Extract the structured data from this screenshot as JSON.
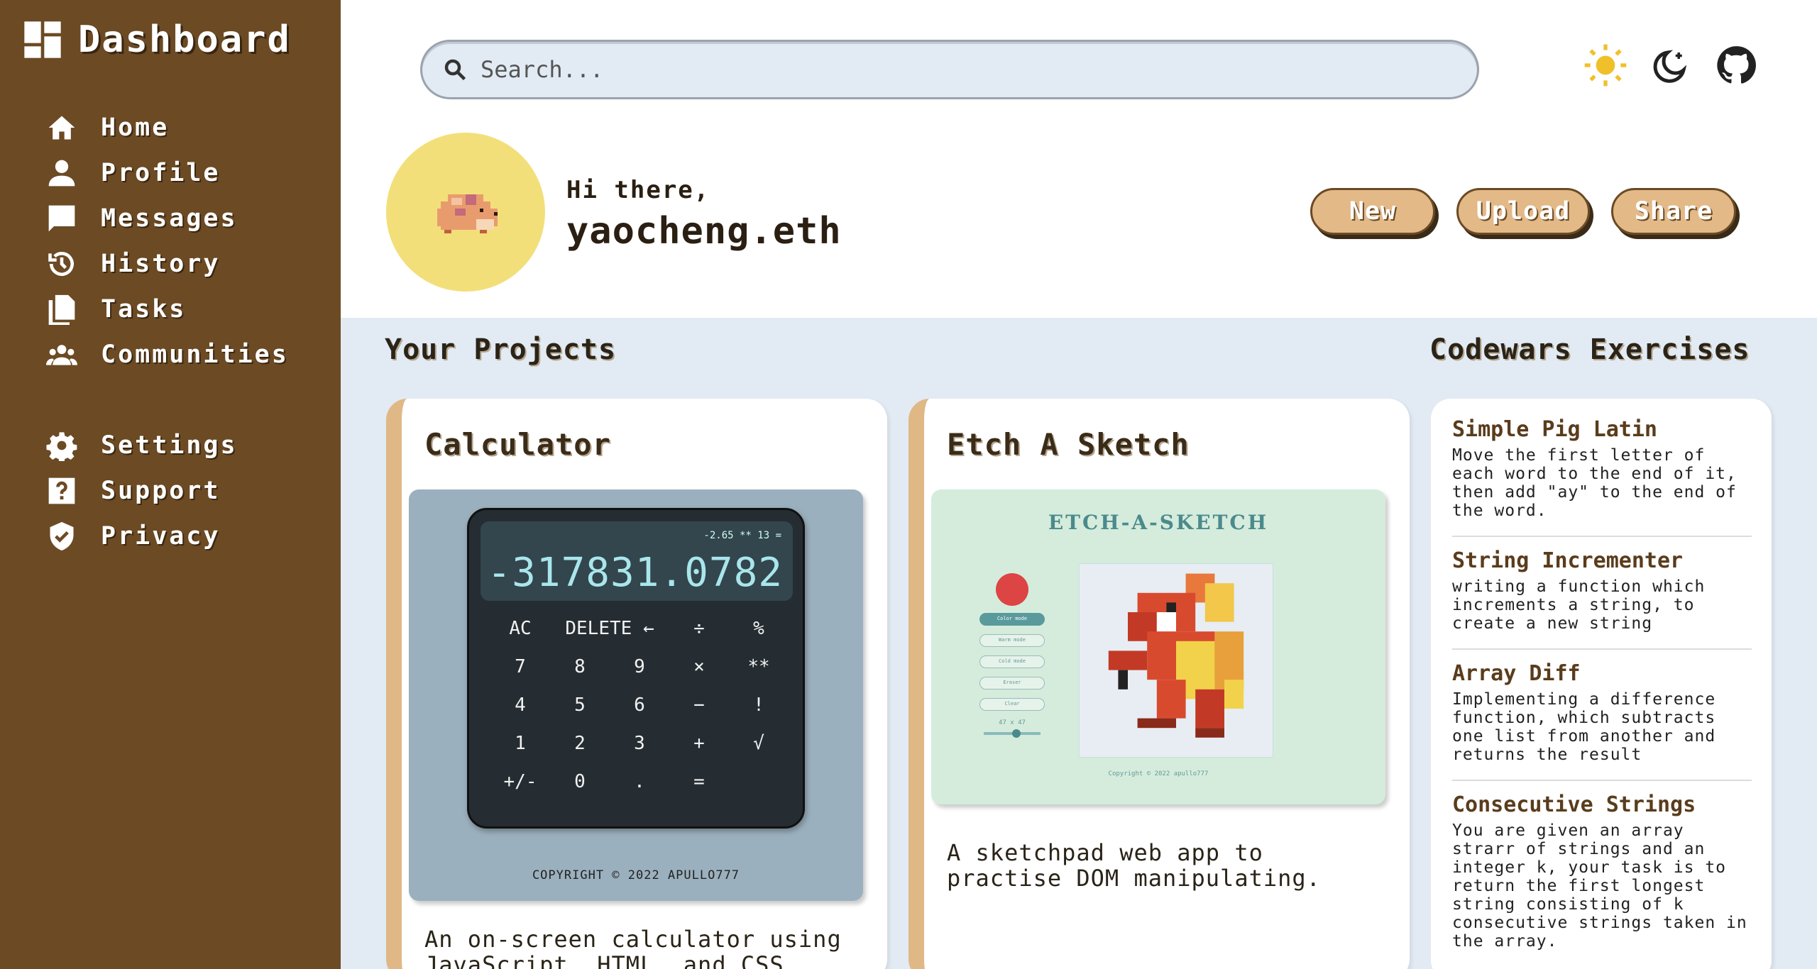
{
  "sidebar": {
    "brand": "Dashboard",
    "items": [
      {
        "label": "Home",
        "icon": "home-icon"
      },
      {
        "label": "Profile",
        "icon": "user-icon"
      },
      {
        "label": "Messages",
        "icon": "message-icon"
      },
      {
        "label": "History",
        "icon": "history-icon"
      },
      {
        "label": "Tasks",
        "icon": "tasks-icon"
      },
      {
        "label": "Communities",
        "icon": "group-icon"
      }
    ],
    "items2": [
      {
        "label": "Settings",
        "icon": "gear-icon"
      },
      {
        "label": "Support",
        "icon": "help-icon"
      },
      {
        "label": "Privacy",
        "icon": "shield-icon"
      }
    ]
  },
  "header": {
    "search_placeholder": "Search...",
    "greeting": "Hi there,",
    "username": "yaocheng.eth",
    "buttons": {
      "new": "New",
      "upload": "Upload",
      "share": "Share"
    }
  },
  "projects": {
    "title": "Your Projects",
    "cards": [
      {
        "title": "Calculator",
        "description": "An on-screen calculator using JavaScript, HTML, and CSS.",
        "preview": {
          "mini": "-2.65 ** 13 =",
          "value": "-317831.0782",
          "keys": [
            "AC",
            "DELETE ←",
            "÷",
            "%",
            "7",
            "8",
            "9",
            "×",
            "**",
            "4",
            "5",
            "6",
            "−",
            "!",
            "1",
            "2",
            "3",
            "+",
            "√",
            "+/-",
            "0",
            ".",
            "="
          ],
          "footer": "COPYRIGHT © 2022 APULLO777"
        }
      },
      {
        "title": "Etch A Sketch",
        "description": "A sketchpad web app to practise DOM manipulating.",
        "preview": {
          "title": "Etch-a-sketch",
          "buttons": [
            "Color mode",
            "Warm mode",
            "Cold mode",
            "Eraser",
            "Clear"
          ],
          "size": "47 x 47",
          "footer": "Copyright © 2022 apullo777"
        }
      }
    ]
  },
  "codewars": {
    "title": "Codewars Exercises",
    "items": [
      {
        "title": "Simple Pig Latin",
        "desc": "Move the first letter of each word to the end of it, then add \"ay\" to the end of the word."
      },
      {
        "title": "String Incrementer",
        "desc": "writing a function which increments a string, to create a new string"
      },
      {
        "title": "Array Diff",
        "desc": "Implementing a difference function, which subtracts one list from another and returns the result"
      },
      {
        "title": "Consecutive Strings",
        "desc": "You are given an array strarr of strings and an integer k, your task is to return the first longest string consisting of k consecutive strings taken in the array."
      }
    ]
  },
  "colors": {
    "sidebar": "#6b4a24",
    "accent": "#e3b988",
    "avatar_bg": "#f3df7a",
    "main_bg": "#e2ebf4"
  }
}
